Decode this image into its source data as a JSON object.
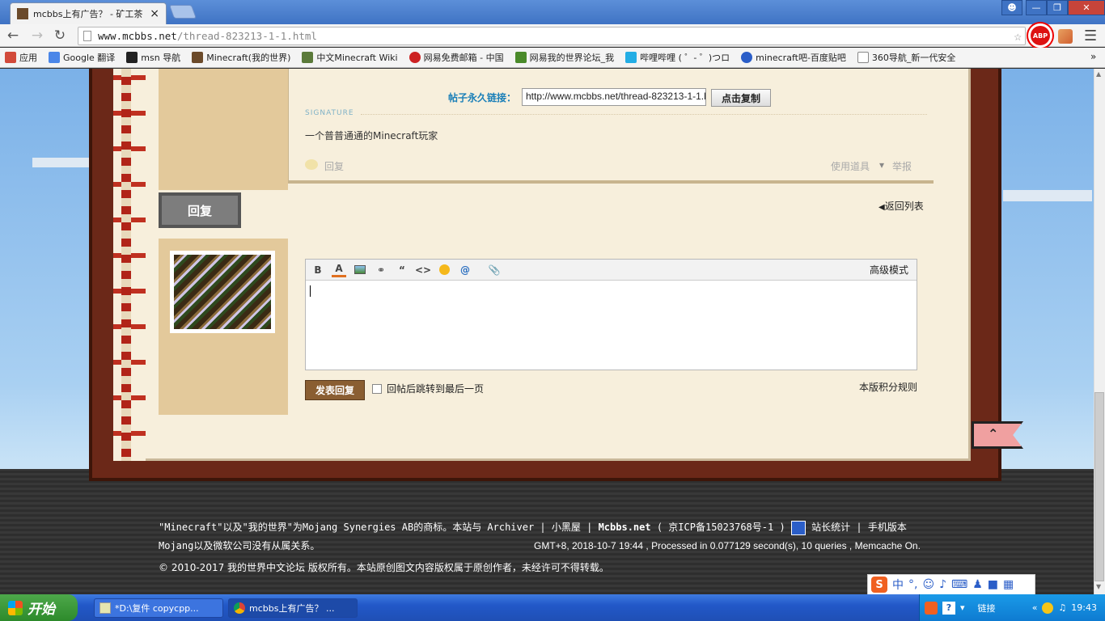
{
  "browser": {
    "tab_title": "mcbbs上有广告？ - 矿工茶",
    "tab_close": "×",
    "url_host": "www.mcbbs.net",
    "url_path": "/thread-823213-1-1.html",
    "abp_label": "ABP",
    "bookmarks": [
      {
        "label": "应用",
        "icon_color": "#d24a3a"
      },
      {
        "label": "Google 翻译",
        "icon_color": "#4a86e8"
      },
      {
        "label": "msn 导航",
        "icon_color": "#222222"
      },
      {
        "label": "Minecraft(我的世界)",
        "icon_color": "#6b4a2a"
      },
      {
        "label": "中文Minecraft Wiki",
        "icon_color": "#5b7a3a"
      },
      {
        "label": "网易免费邮箱 - 中国",
        "icon_color": "#cc2222"
      },
      {
        "label": "网易我的世界论坛_我",
        "icon_color": "#4a8a2a"
      },
      {
        "label": "哔哩哔哩 ( ゜- ゜)つロ",
        "icon_color": "#23ade5"
      },
      {
        "label": "minecraft吧-百度贴吧",
        "icon_color": "#2b5ec8"
      },
      {
        "label": "360导航_新一代安全",
        "icon_color": "#888888"
      }
    ]
  },
  "post": {
    "permalink_label": "帖子永久链接：",
    "permalink_value": "http://www.mcbbs.net/thread-823213-1-1.html",
    "copy_button": "点击复制",
    "signature_label": "SIGNATURE",
    "signature_text": "一个普普通通的Minecraft玩家",
    "reply_link": "回复",
    "use_tool": "使用道具",
    "report": "举报"
  },
  "reply": {
    "title": "回复",
    "back_to_list": "返回列表",
    "advanced_mode": "高级模式",
    "submit": "发表回复",
    "jump_label": "回帖后跳转到最后一页",
    "rules": "本版积分规则"
  },
  "footer": {
    "line1a": "\"Minecraft\"以及\"我的世界\"为Mojang Synergies AB的商标。本站与 Archiver | 小黑屋 |",
    "site_name": "Mcbbs.net",
    "line1b": "( 京ICP备15023768号-1 )",
    "stats": "站长统计",
    "mobile": "| 手机版本",
    "line2": "Mojang以及微软公司没有从属关系。",
    "server_info": "GMT+8, 2018-10-7 19:44 , Processed in 0.077129 second(s), 10 queries , Memcache On.",
    "line3": "© 2010-2017 我的世界中文论坛 版权所有。本站原创图文内容版权属于原创作者，未经许可不得转载。"
  },
  "ime": {
    "label": "中",
    "punct": "°,"
  },
  "taskbar": {
    "start": "开始",
    "tasks": [
      "*D:\\复件 copycpp...",
      "mcbbs上有广告？ ..."
    ],
    "links": "链接",
    "clock": "19:43"
  }
}
